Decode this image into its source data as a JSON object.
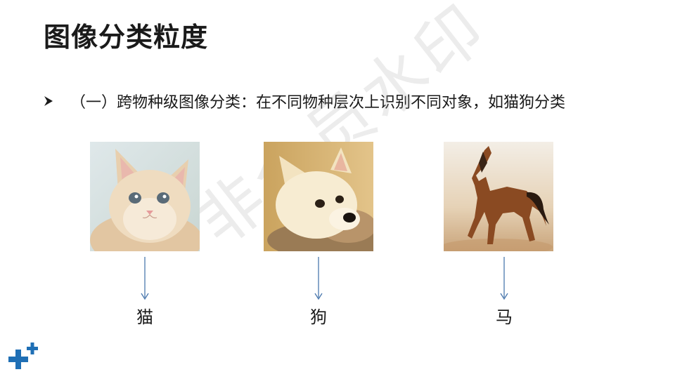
{
  "slide": {
    "title": "图像分类粒度",
    "bullet_text": "（一）跨物种级图像分类：在不同物种层次上识别不同对象，如猫狗分类",
    "watermark": "非会员水印",
    "accent_color": "#1f6fb5"
  },
  "examples": [
    {
      "label": "猫",
      "image": "kitten-photo"
    },
    {
      "label": "狗",
      "image": "puppy-photo"
    },
    {
      "label": "马",
      "image": "horse-photo"
    }
  ]
}
